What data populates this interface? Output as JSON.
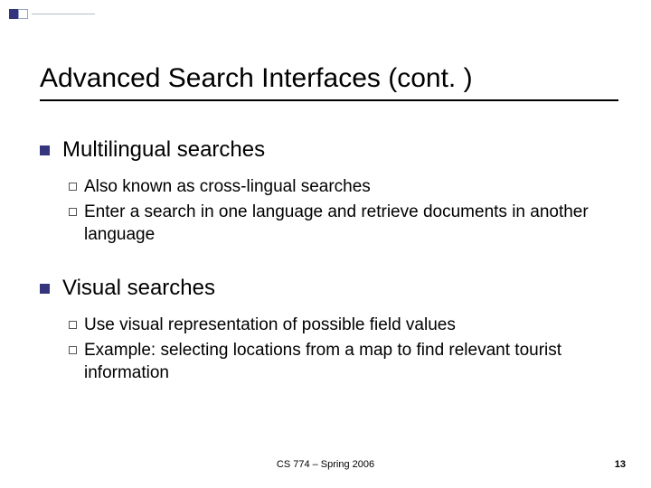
{
  "title": "Advanced Search Interfaces (cont. )",
  "sections": [
    {
      "heading": "Multilingual searches",
      "items": [
        "Also known as cross-lingual searches",
        "Enter a search in one language and retrieve documents in another language"
      ]
    },
    {
      "heading": "Visual searches",
      "items": [
        "Use visual representation of possible field values",
        "Example: selecting locations from a map to find relevant tourist information"
      ]
    }
  ],
  "footer": {
    "center": "CS 774 – Spring 2006",
    "page": "13"
  }
}
